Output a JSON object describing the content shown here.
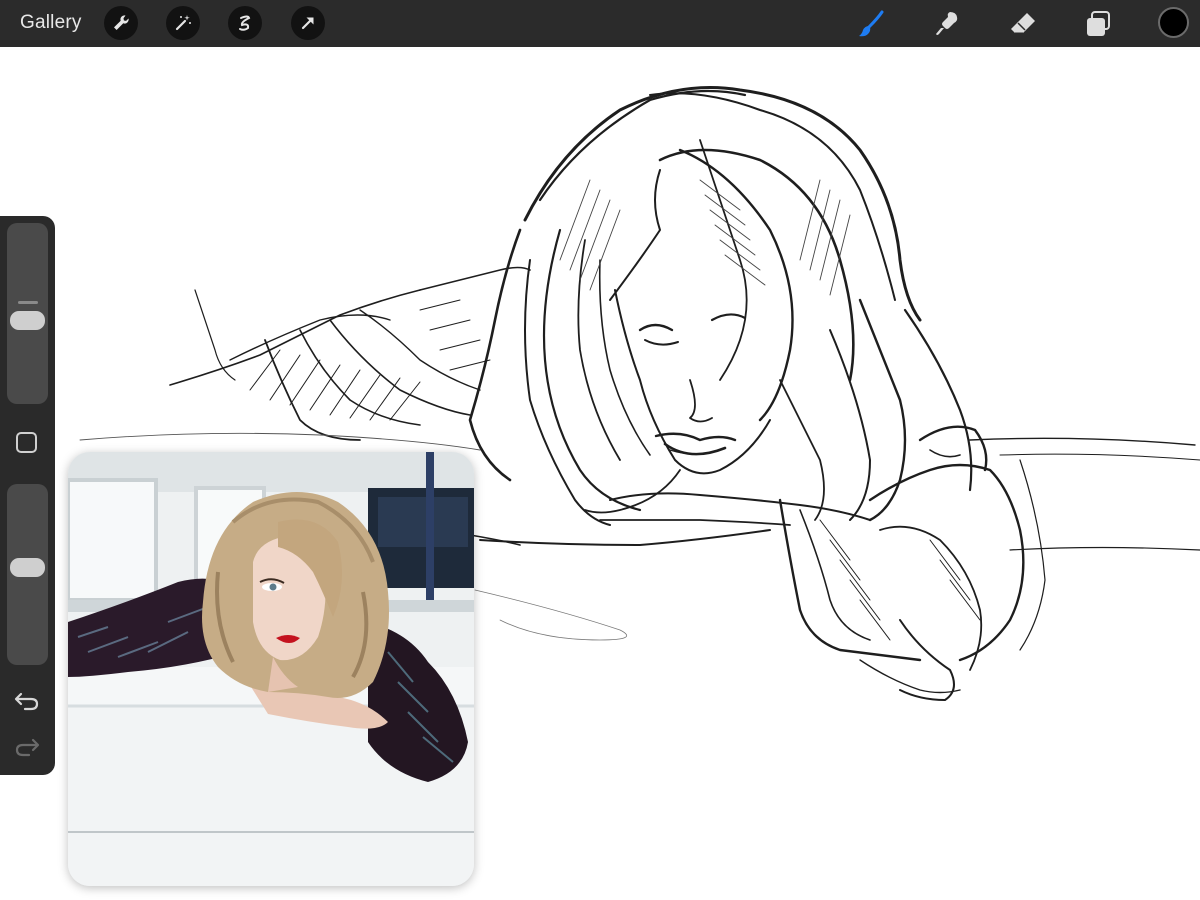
{
  "topbar": {
    "gallery_label": "Gallery",
    "left_tools": [
      "wrench-icon",
      "magic-wand-icon",
      "selection-icon",
      "transform-arrow-icon"
    ],
    "right_tools": [
      "brush-icon",
      "smudge-icon",
      "eraser-icon",
      "layers-icon"
    ],
    "active_tool": "brush-icon",
    "active_tool_color": "#1e7cf2",
    "current_color": "#000000"
  },
  "sidebar": {
    "brush_size_level": 0.45,
    "opacity_level": 0.45,
    "controls": [
      "brush-size-slider",
      "modify-button",
      "opacity-slider",
      "undo-button",
      "redo-button"
    ]
  },
  "reference": {
    "type": "photo-reference-window"
  }
}
